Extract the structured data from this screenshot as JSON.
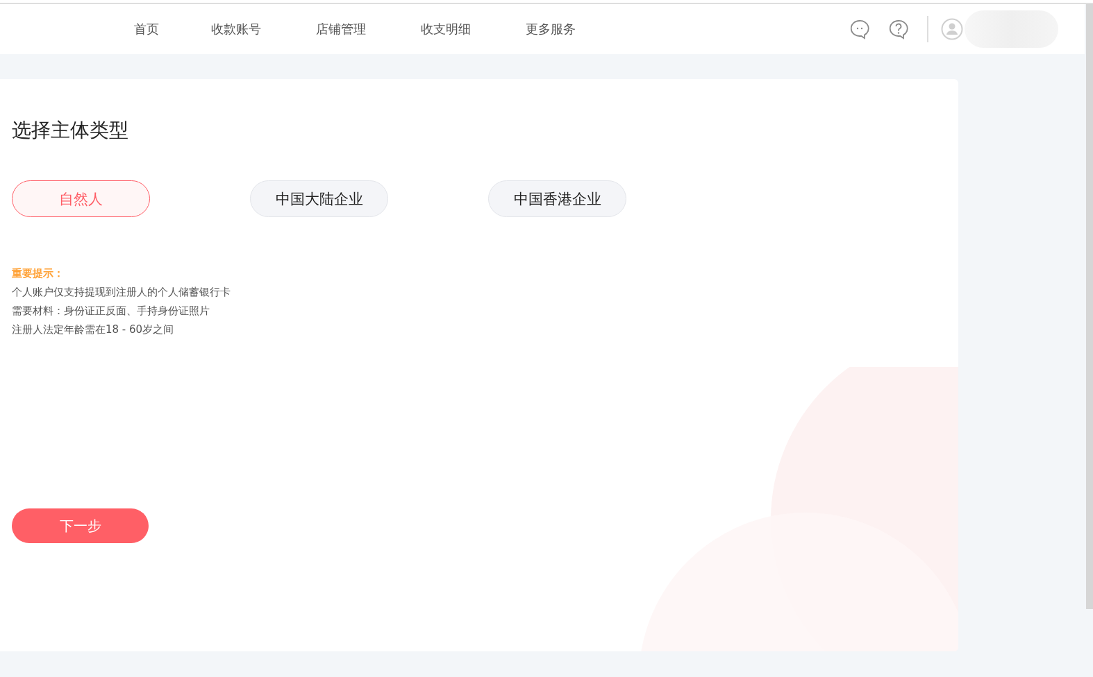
{
  "nav": {
    "items": [
      "首页",
      "收款账号",
      "店铺管理",
      "收支明细",
      "更多服务"
    ]
  },
  "page": {
    "title": "选择主体类型",
    "options": [
      {
        "label": "自然人",
        "selected": true
      },
      {
        "label": "中国大陆企业",
        "selected": false
      },
      {
        "label": "中国香港企业",
        "selected": false
      }
    ],
    "notice": {
      "title": "重要提示：",
      "lines": [
        "个人账户仅支持提现到注册人的个人储蓄银行卡",
        "需要材料：身份证正反面、手持身份证照片",
        "注册人法定年龄需在18 - 60岁之间"
      ]
    },
    "next_button": "下一步"
  }
}
